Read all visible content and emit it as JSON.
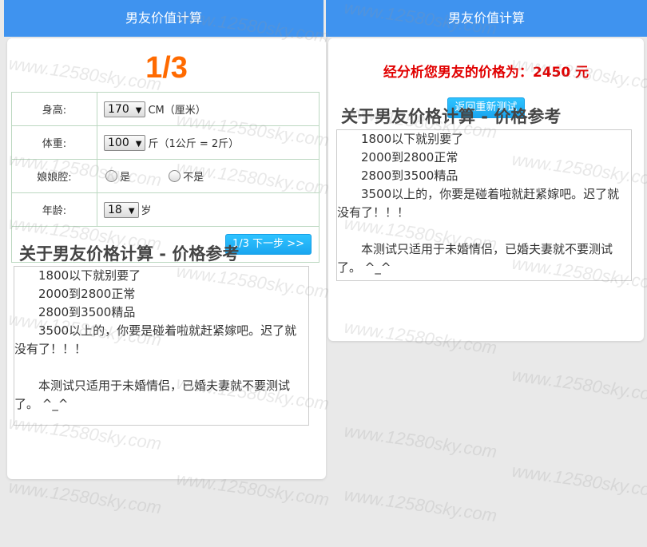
{
  "left": {
    "header_title": "男友价值计算",
    "step": "1/3",
    "form": {
      "height": {
        "label": "身高:",
        "value": "170",
        "unit": "CM（厘米）"
      },
      "weight": {
        "label": "体重:",
        "value": "100",
        "unit": "斤（1公斤 = 2斤）"
      },
      "sissy": {
        "label": "娘娘腔:",
        "options": [
          "是",
          "不是"
        ]
      },
      "age": {
        "label": "年龄:",
        "value": "18",
        "unit": "岁"
      },
      "next_label": "1/3 下一步 >>"
    }
  },
  "right": {
    "header_title": "男友价值计算",
    "result_text": "经分析您男友的价格为：2450 元",
    "retry_label": "返回重新测试"
  },
  "reference": {
    "heading": "关于男友价格计算 - 价格参考",
    "lines": [
      "1800以下就别要了",
      "2000到2800正常",
      "2800到3500精品",
      "3500以上的，你要是碰着啦就赶紧嫁吧。迟了就没有了！！！"
    ],
    "note": "本测试只适用于未婚情侣，已婚夫妻就不要测试了。 ^_^"
  },
  "watermark": "www.12580sky.com",
  "colors": {
    "header": "#3f93ef",
    "step": "#ff6a00",
    "result": "#e10000",
    "button": "#1aa6f0"
  }
}
